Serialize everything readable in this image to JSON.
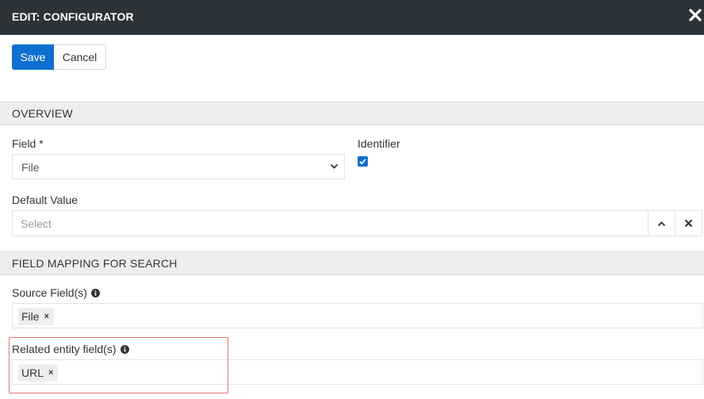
{
  "window": {
    "title": "EDIT: CONFIGURATOR",
    "close_icon": "close-icon"
  },
  "toolbar": {
    "save_label": "Save",
    "cancel_label": "Cancel"
  },
  "overview": {
    "section_title": "OVERVIEW",
    "field": {
      "label": "Field *",
      "value": "File"
    },
    "identifier": {
      "label": "Identifier",
      "checked": true
    },
    "default_value": {
      "label": "Default Value",
      "placeholder": "Select"
    }
  },
  "field_mapping": {
    "section_title": "FIELD MAPPING FOR SEARCH",
    "source_fields": {
      "label": "Source Field(s)",
      "tags": [
        "File"
      ]
    },
    "related_entity_fields": {
      "label": "Related entity field(s)",
      "tags": [
        "URL"
      ]
    }
  },
  "colors": {
    "accent": "#0f6fd0",
    "titlebar": "#2b3238",
    "highlight": "#e8706f"
  }
}
